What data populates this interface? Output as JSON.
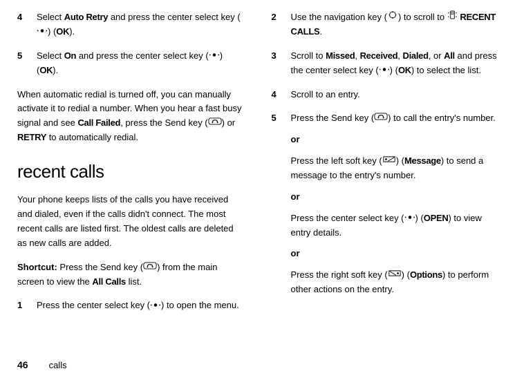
{
  "left": {
    "step4": {
      "num": "4",
      "t1": "Select ",
      "bold1": "Auto Retry",
      "t2": " and press the center select key (",
      "t3": ") (",
      "bold2": "OK",
      "t4": ")."
    },
    "step5": {
      "num": "5",
      "t1": "Select ",
      "bold1": "On",
      "t2": " and press the center select key (",
      "t3": ") (",
      "bold2": "OK",
      "t4": ")."
    },
    "para1": {
      "t1": "When automatic redial is turned off, you can manually activate it to redial a number. When you hear a fast busy signal and see ",
      "b1": "Call Failed",
      "t2": ", press the Send key (",
      "t3": ") or ",
      "b2": "RETRY",
      "t4": " to automatically redial."
    },
    "heading": "recent calls",
    "para2": "Your phone keeps lists of the calls you have received and dialed, even if the calls didn't connect. The most recent calls are listed first. The oldest calls are deleted as new calls are added.",
    "shortcut": {
      "b1": "Shortcut:",
      "t1": " Press the Send key (",
      "t2": ") from the main screen to view the ",
      "b2": "All Calls",
      "t3": " list."
    },
    "step1": {
      "num": "1",
      "t1": "Press the center select key (",
      "t2": ") to open the menu."
    }
  },
  "right": {
    "step2": {
      "num": "2",
      "t1": "Use the navigation key (",
      "t2": ") to scroll to ",
      "b1": "RECENT CALLS",
      "t3": "."
    },
    "step3": {
      "num": "3",
      "t1": "Scroll to ",
      "b1": "Missed",
      "t2": ", ",
      "b2": "Received",
      "t3": ", ",
      "b3": "Dialed",
      "t4": ", or ",
      "b4": "All",
      "t5": " and press the center select key (",
      "t6": ") (",
      "b5": "OK",
      "t7": ") to select the list."
    },
    "step4": {
      "num": "4",
      "t1": "Scroll to an entry."
    },
    "step5": {
      "num": "5",
      "t1": "Press the Send key (",
      "t2": ") to call the entry's number."
    },
    "or": "or",
    "opt1": {
      "t1": "Press the left soft key (",
      "t2": ") (",
      "b1": "Message",
      "t3": ") to send a message to the entry's number."
    },
    "opt2": {
      "t1": "Press the center select key (",
      "t2": ") (",
      "b1": "OPEN",
      "t3": ") to view entry details."
    },
    "opt3": {
      "t1": "Press the right soft key (",
      "t2": ") (",
      "b1": "Options",
      "t3": ") to perform other actions on the entry."
    }
  },
  "footer": {
    "page": "46",
    "label": "calls"
  }
}
